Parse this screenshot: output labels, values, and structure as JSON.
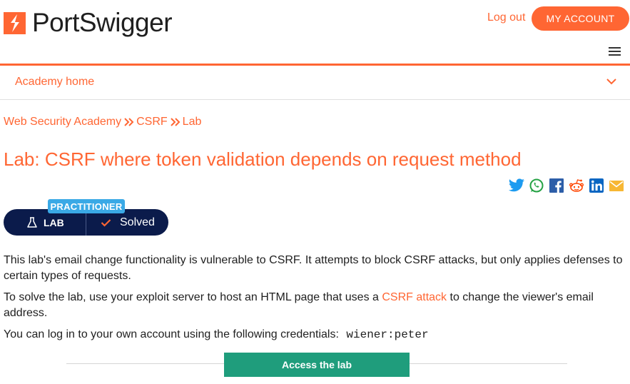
{
  "header": {
    "brand": "PortSwigger",
    "logout_label": "Log out",
    "account_label": "MY ACCOUNT",
    "accent_color": "#ff6633"
  },
  "nav": {
    "label": "Academy home"
  },
  "breadcrumb": {
    "items": [
      "Web Security Academy",
      "CSRF",
      "Lab"
    ]
  },
  "title": "Lab: CSRF where token validation depends on request method",
  "share": [
    "twitter-icon",
    "whatsapp-icon",
    "facebook-icon",
    "reddit-icon",
    "linkedin-icon",
    "email-icon"
  ],
  "lab": {
    "level": "PRACTITIONER",
    "type_label": "LAB",
    "status": "Solved"
  },
  "content": {
    "p1": "This lab's email change functionality is vulnerable to CSRF. It attempts to block CSRF attacks, but only applies defenses to certain types of requests.",
    "p2_before": "To solve the lab, use your exploit server to host an HTML page that uses a ",
    "p2_link": "CSRF attack",
    "p2_after": " to change the viewer's email address.",
    "p3": "You can log in to your own account using the following credentials:",
    "credentials": "wiener:peter"
  },
  "access_button": "Access the lab"
}
